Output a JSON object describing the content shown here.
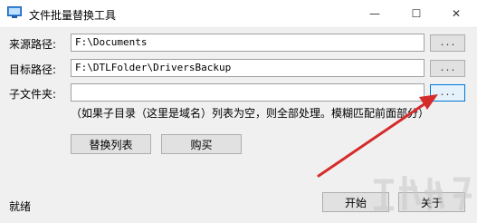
{
  "window": {
    "title": "文件批量替换工具",
    "minimize_glyph": "—",
    "maximize_glyph": "☐",
    "close_glyph": "✕"
  },
  "form": {
    "source_label": "来源路径:",
    "source_value": "F:\\Documents",
    "target_label": "目标路径:",
    "target_value": "F:\\DTLFolder\\DriversBackup",
    "subfolder_label": "子文件夹:",
    "subfolder_value": "",
    "browse_label": "...",
    "hint": "（如果子目录（这里是域名）列表为空，则全部处理。模糊匹配前面部分）"
  },
  "buttons": {
    "replace_list": "替换列表",
    "buy": "购买",
    "start": "开始",
    "about": "关于"
  },
  "status": "就绪",
  "colors": {
    "arrow": "#d62b2b",
    "focus_border": "#0078d7"
  },
  "icons": {
    "app": "window-icon",
    "annotation": "red-arrow"
  }
}
